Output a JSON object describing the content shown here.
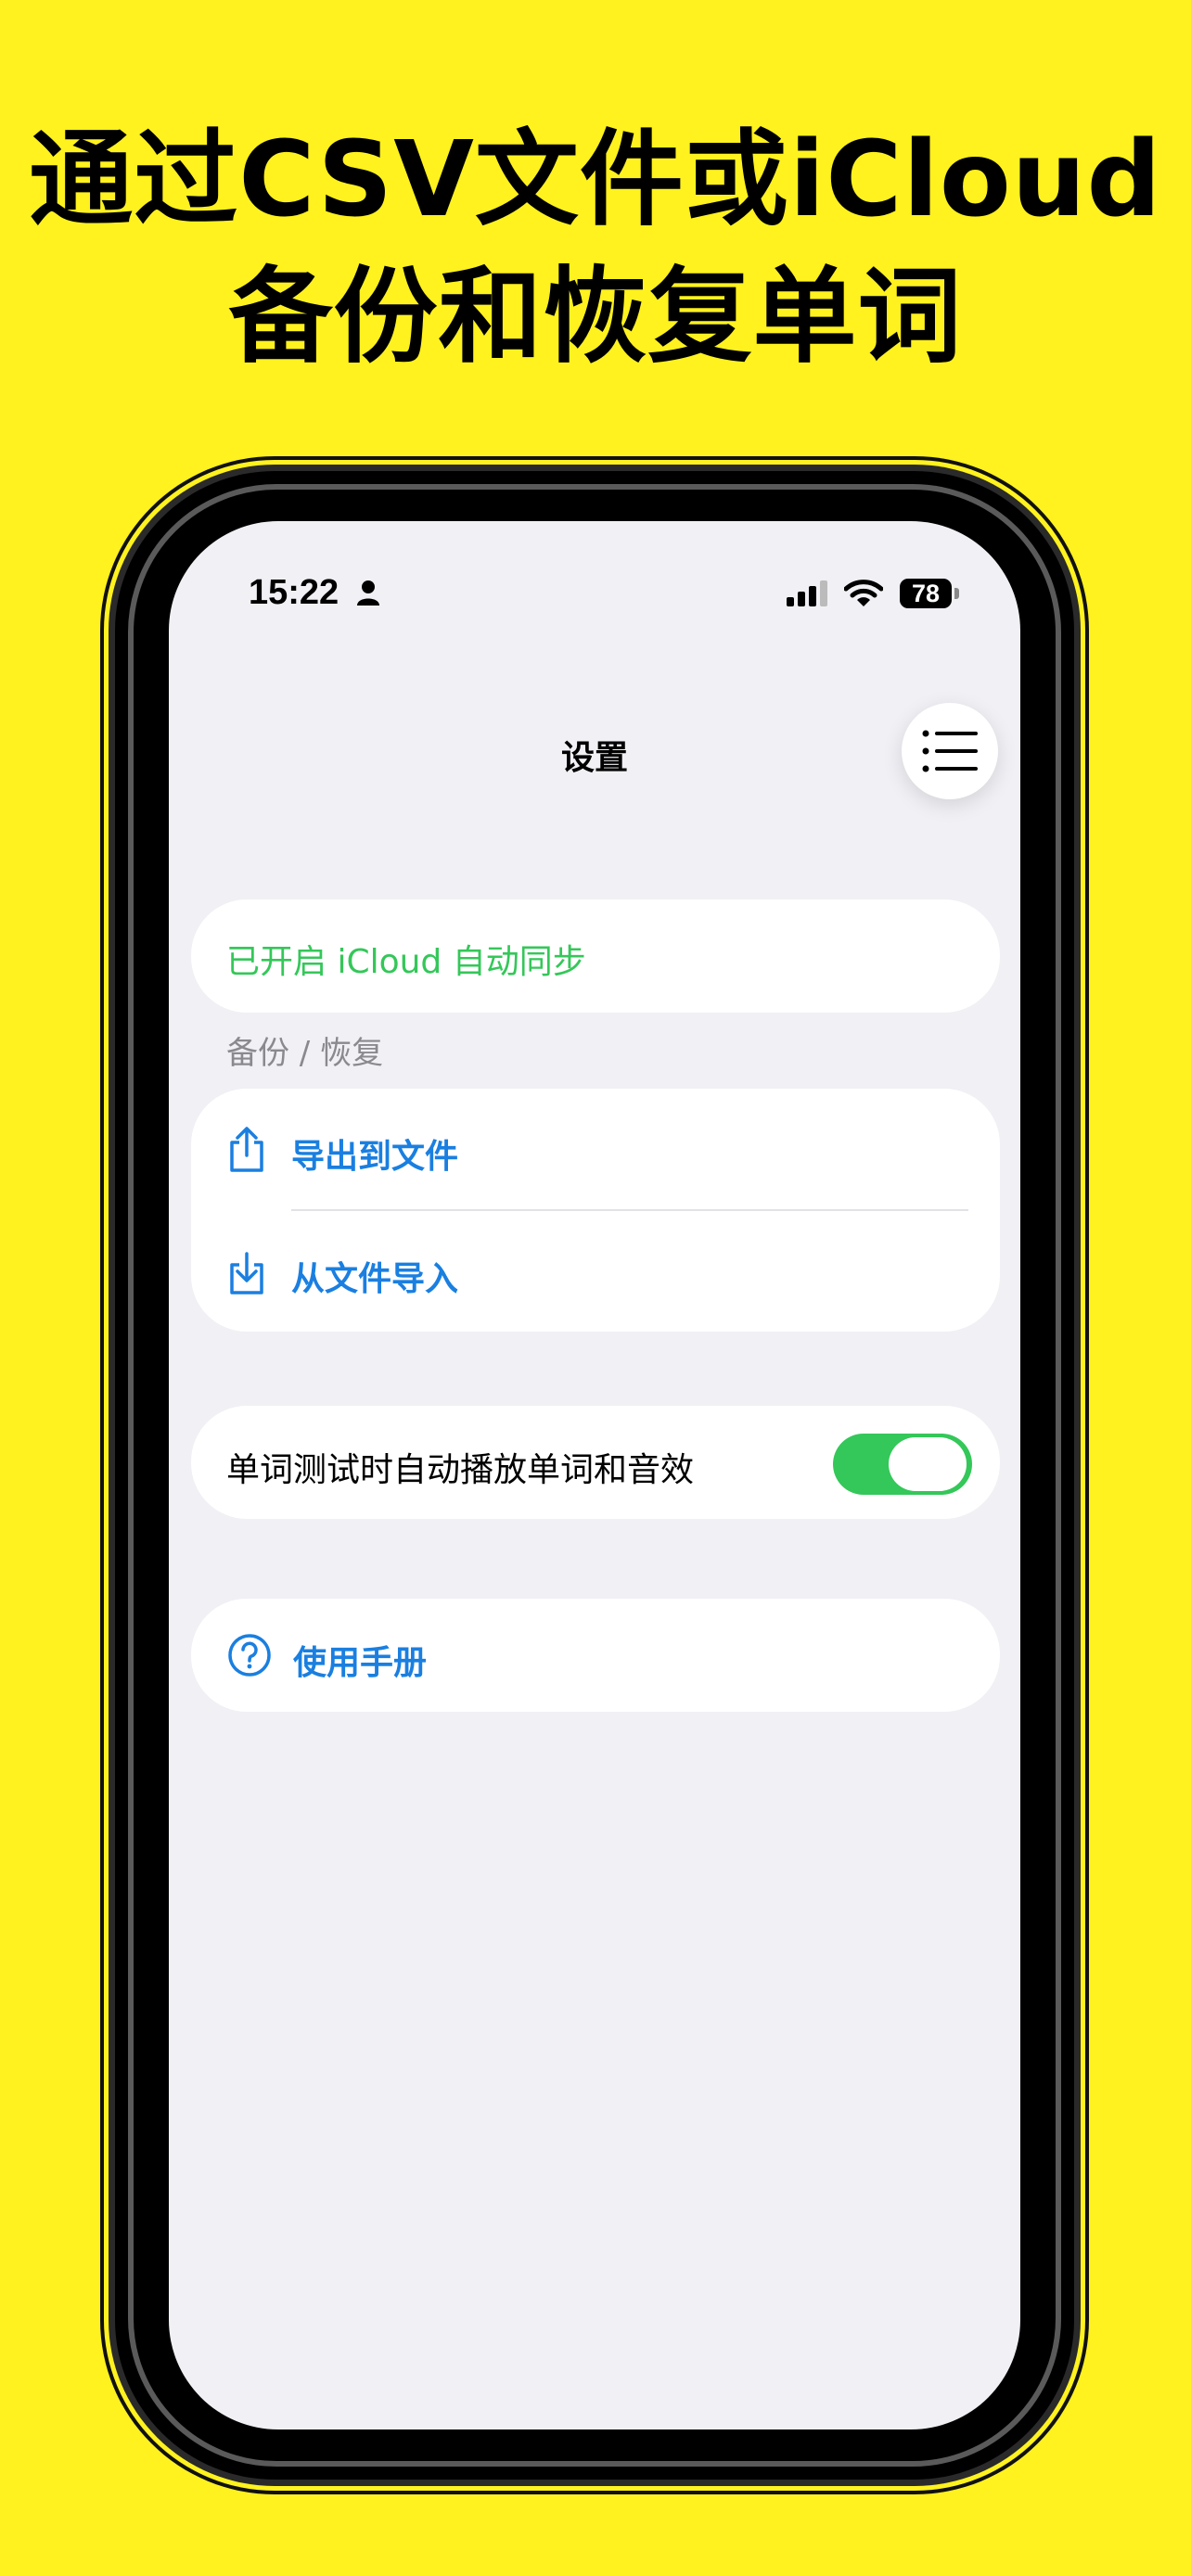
{
  "headline": {
    "line1": "通过CSV文件或iCloud",
    "line2": "备份和恢复单词"
  },
  "status_bar": {
    "time": "15:22",
    "battery": "78"
  },
  "nav": {
    "title": "设置",
    "menu_icon": "list-icon"
  },
  "sync": {
    "text": "已开启 iCloud 自动同步"
  },
  "backup": {
    "section_title": "备份 / 恢复",
    "export_label": "导出到文件",
    "import_label": "从文件导入"
  },
  "settings": {
    "auto_play_label": "单词测试时自动播放单词和音效",
    "auto_play_enabled": true
  },
  "help": {
    "manual_label": "使用手册"
  },
  "colors": {
    "background": "#FFF21E",
    "accent_blue": "#1A7FE0",
    "accent_green": "#34C759",
    "screen_bg": "#F0F0F5"
  }
}
